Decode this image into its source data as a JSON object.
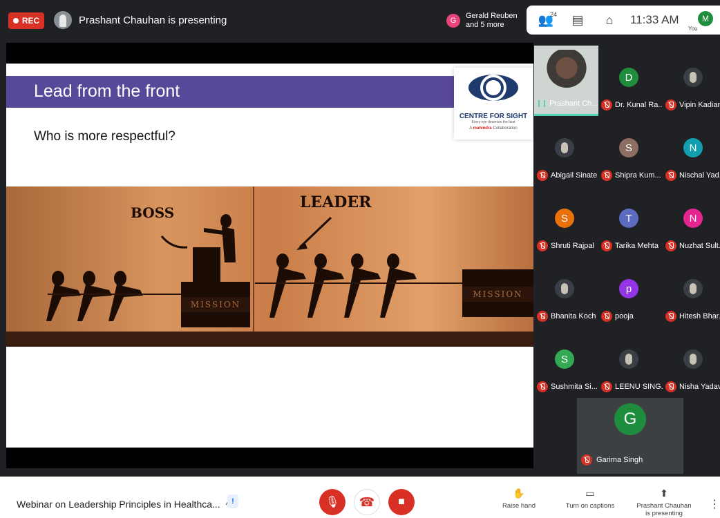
{
  "top_bar": {
    "rec_label": "REC",
    "presenting_text": "Prashant Chauhan is presenting",
    "others_initial": "G",
    "others_text_line1": "Gerald Reuben",
    "others_text_line2": "and 5 more",
    "participant_count": "24",
    "clock": "11:33 AM",
    "self_initial": "M",
    "self_label": "You"
  },
  "slide": {
    "title": "Lead from the front",
    "question": "Who is more respectful?",
    "logo_brand": "CENTRE FOR SIGHT",
    "logo_tagline": "Every eye deserves the best",
    "logo_collab_prefix": "A",
    "logo_collab_company": "mahindra",
    "logo_collab_suffix": "Collaboration",
    "art_boss": "BOSS",
    "art_leader": "LEADER",
    "art_mission": "MISSION"
  },
  "participants": [
    {
      "name": "Prashant Ch...",
      "presenter": true
    },
    {
      "name": "Dr. Kunal Ra...",
      "initial": "D",
      "color": "#1e8e3e"
    },
    {
      "name": "Vipin Kadian",
      "photo": true
    },
    {
      "name": "Abigail Sinate",
      "photo": true
    },
    {
      "name": "Shipra Kum...",
      "initial": "S",
      "color": "#8d6e63"
    },
    {
      "name": "Nischal Yad...",
      "initial": "N",
      "color": "#129eaf"
    },
    {
      "name": "Shruti Rajpal",
      "initial": "S",
      "color": "#e8710a"
    },
    {
      "name": "Tarika Mehta",
      "initial": "T",
      "color": "#5c6bc0"
    },
    {
      "name": "Nuzhat Sult...",
      "initial": "N",
      "color": "#e52592"
    },
    {
      "name": "Bhanita Koch",
      "photo": true
    },
    {
      "name": "pooja",
      "initial": "p",
      "color": "#9334e6"
    },
    {
      "name": "Hitesh Bhar...",
      "photo": true
    },
    {
      "name": "Sushmita Si...",
      "initial": "S",
      "color": "#34a853"
    },
    {
      "name": "LEENU SING...",
      "photo": true
    },
    {
      "name": "Nisha Yadav",
      "photo": true
    }
  ],
  "spotlight": {
    "name": "Garima Singh",
    "initial": "G"
  },
  "bottom_bar": {
    "meeting_title": "Webinar on Leadership Principles in Healthca...",
    "raise_hand": "Raise hand",
    "captions": "Turn on captions",
    "present_line1": "Prashant Chauhan",
    "present_line2": "is presenting"
  }
}
